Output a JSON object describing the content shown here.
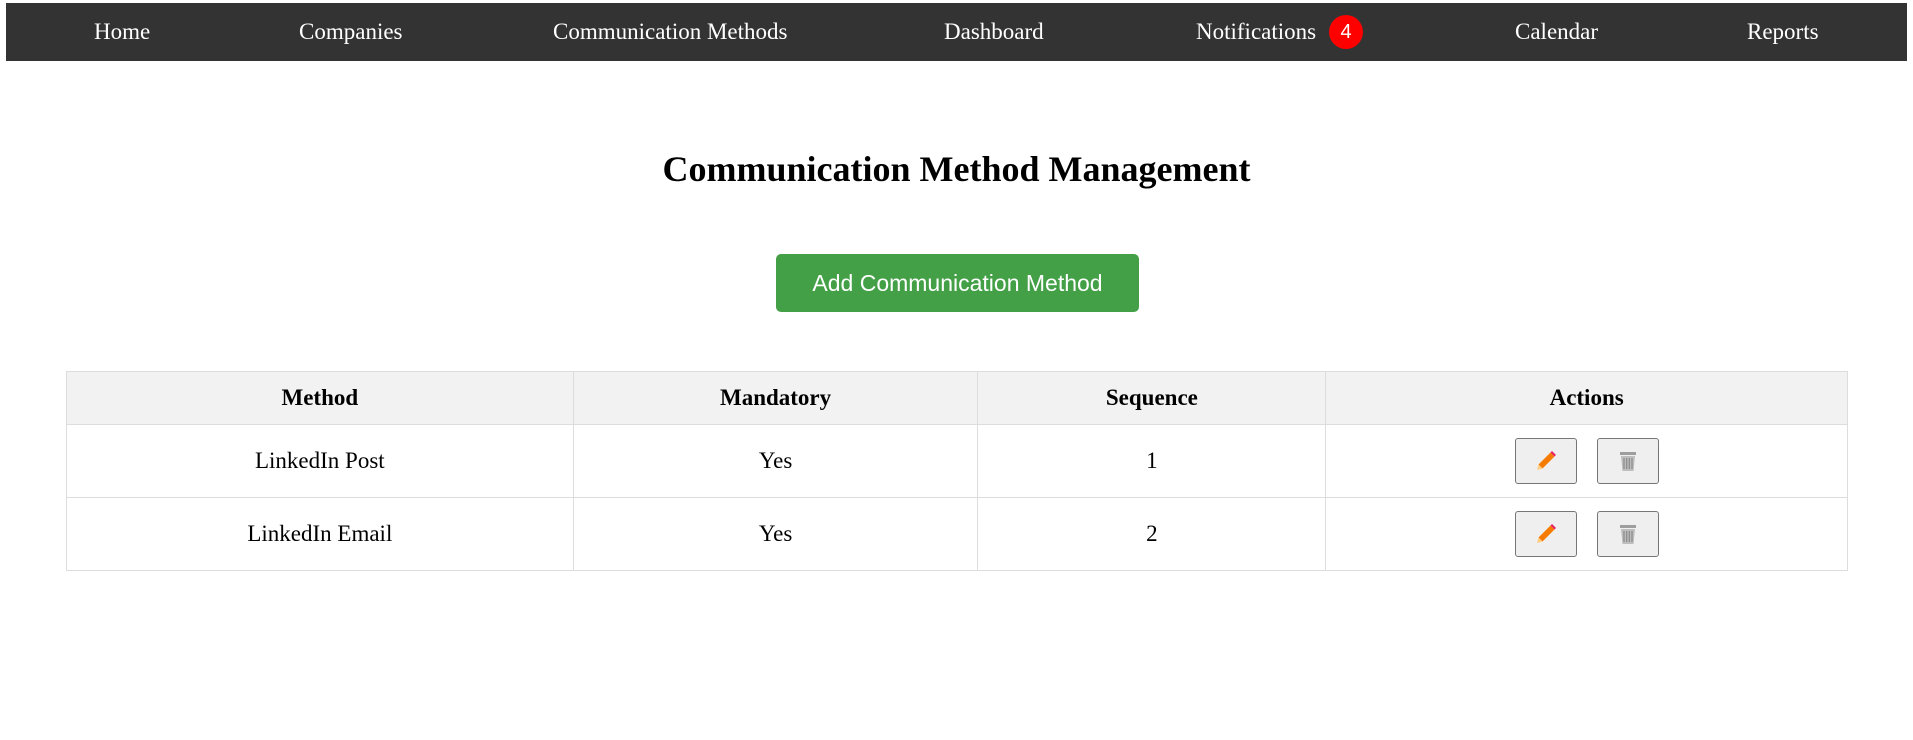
{
  "nav": {
    "items": [
      {
        "label": "Home"
      },
      {
        "label": "Companies"
      },
      {
        "label": "Communication Methods"
      },
      {
        "label": "Dashboard"
      },
      {
        "label": "Notifications",
        "badge": "4"
      },
      {
        "label": "Calendar"
      },
      {
        "label": "Reports"
      }
    ]
  },
  "page": {
    "title": "Communication Method Management",
    "add_button_label": "Add Communication Method"
  },
  "table": {
    "headers": [
      "Method",
      "Mandatory",
      "Sequence",
      "Actions"
    ],
    "rows": [
      {
        "method": "LinkedIn Post",
        "mandatory": "Yes",
        "sequence": "1"
      },
      {
        "method": "LinkedIn Email",
        "mandatory": "Yes",
        "sequence": "2"
      }
    ]
  },
  "icons": {
    "edit": "pencil-icon",
    "delete": "trash-icon"
  },
  "colors": {
    "navbar": "#333333",
    "badge": "#ff0000",
    "add_button": "#43a047",
    "header_row": "#f2f2f2",
    "pencil": "#f57c00"
  }
}
